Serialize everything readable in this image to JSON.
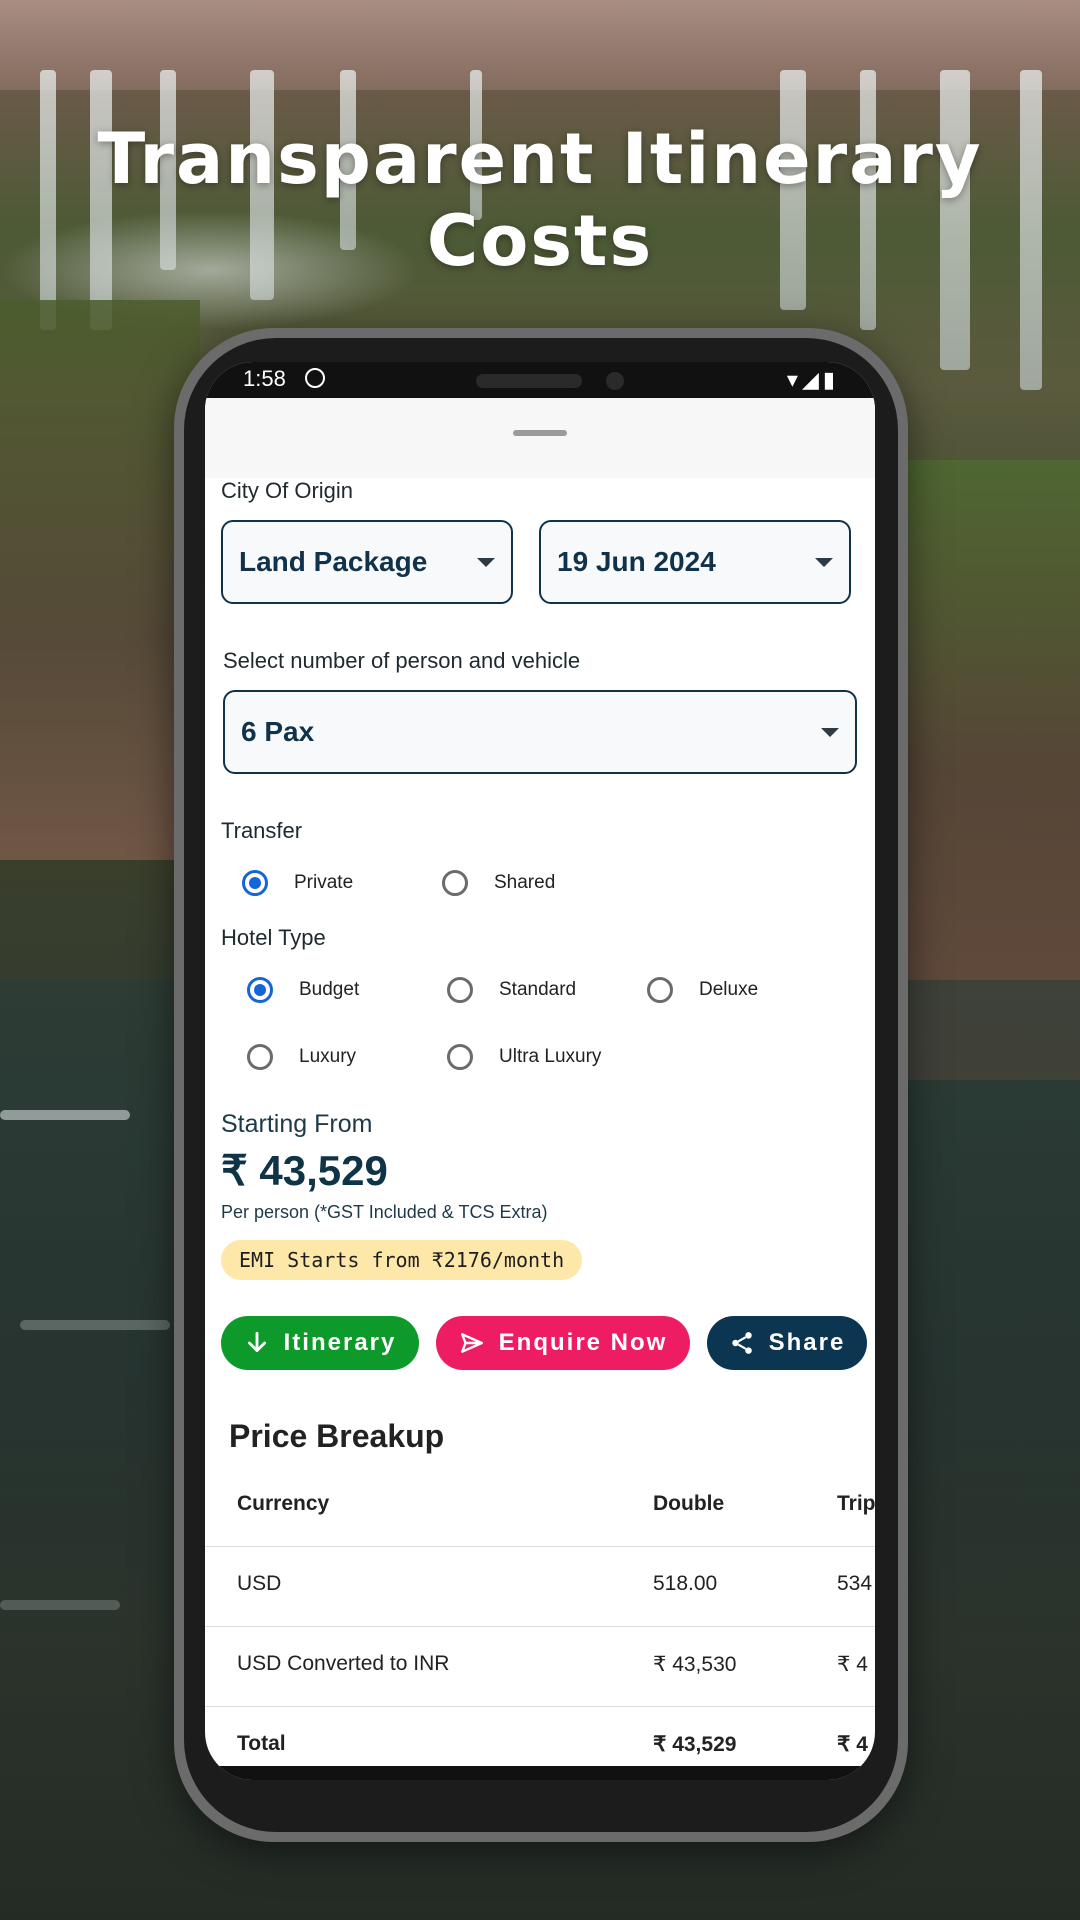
{
  "headline": "Transparent Itinerary Costs",
  "status": {
    "time": "1:58",
    "right_icons": "▾◢▮"
  },
  "form": {
    "city_label": "City Of Origin",
    "package": "Land Package",
    "date": "19 Jun 2024",
    "pax_label": "Select number of person and vehicle",
    "pax": "6 Pax",
    "transfer_label": "Transfer",
    "transfer_options": [
      "Private",
      "Shared"
    ],
    "transfer_selected": "Private",
    "hotel_label": "Hotel Type",
    "hotel_options": [
      "Budget",
      "Standard",
      "Deluxe",
      "Luxury",
      "Ultra Luxury"
    ],
    "hotel_selected": "Budget"
  },
  "pricing": {
    "starting_label": "Starting From",
    "price": "₹ 43,529",
    "note": "Per person (*GST Included & TCS Extra)",
    "emi": "EMI Starts from ₹2176/month"
  },
  "buttons": {
    "itinerary": "Itinerary",
    "enquire": "Enquire Now",
    "share": "Share"
  },
  "colors": {
    "itinerary": "#0e9a2b",
    "enquire": "#ee1d63",
    "share": "#0b3550",
    "accent": "#1565d8"
  },
  "price_breakup": {
    "title": "Price Breakup",
    "headers": [
      "Currency",
      "Double",
      "Trip"
    ],
    "rows": [
      [
        "USD",
        "518.00",
        "534"
      ],
      [
        "USD Converted to INR",
        "₹ 43,530",
        "₹ 4"
      ],
      [
        "Total",
        "₹ 43,529",
        "₹ 4"
      ]
    ]
  }
}
